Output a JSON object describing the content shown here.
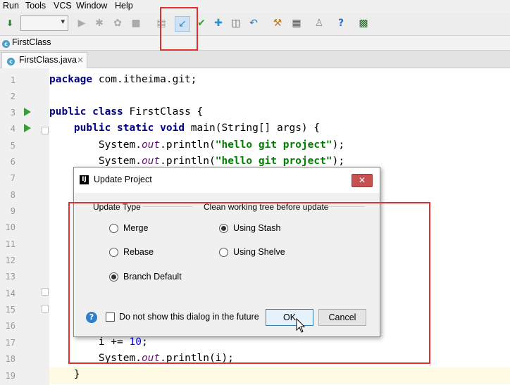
{
  "menu": [
    "Run",
    "Tools",
    "VCS",
    "Window",
    "Help"
  ],
  "breadcrumb": {
    "label": "FirstClass",
    "icon": "class-c-icon"
  },
  "tab": {
    "label": "FirstClass.java",
    "close": "×"
  },
  "editor": {
    "line_numbers": [
      "1",
      "2",
      "3",
      "4",
      "5",
      "6",
      "7",
      "8",
      "9",
      "10",
      "11",
      "12",
      "13",
      "14",
      "15",
      "16",
      "17",
      "18",
      "19"
    ],
    "code": {
      "l1_kw": "package",
      "l1_rest": " com.itheima.git;",
      "l3_kw": "public class",
      "l3_rest": " FirstClass {",
      "l4_kw": "    public static void",
      "l4_rest": " main(String[] args) {",
      "l5_a": "        System.",
      "l5_it": "out",
      "l5_b": ".println(",
      "l5_str": "\"hello git project\"",
      "l5_c": ");",
      "l6_a": "        System.",
      "l6_it": "out",
      "l6_b": ".println(",
      "l6_str": "\"hello git project\"",
      "l6_c": ");",
      "l17_a": "        i += ",
      "l17_num": "10",
      "l17_b": ";",
      "l18_a": "        System.",
      "l18_it": "out",
      "l18_b": ".println(i);",
      "l19": "    }"
    }
  },
  "dialog": {
    "title": "Update Project",
    "close": "✕",
    "update_type_label": "Update Type",
    "clean_tree_label": "Clean working tree before update",
    "options_left": [
      {
        "label": "Merge",
        "checked": false
      },
      {
        "label": "Rebase",
        "checked": false
      },
      {
        "label": "Branch Default",
        "checked": true
      }
    ],
    "options_right": [
      {
        "label": "Using Stash",
        "checked": true
      },
      {
        "label": "Using Shelve",
        "checked": false
      }
    ],
    "checkbox_label": "Do not show this dialog in the future",
    "ok_label": "OK",
    "cancel_label": "Cancel",
    "help": "?"
  },
  "colors": {
    "highlight_box": "#e03030",
    "keyword": "#000080",
    "string": "#008000",
    "field": "#660e7a"
  }
}
